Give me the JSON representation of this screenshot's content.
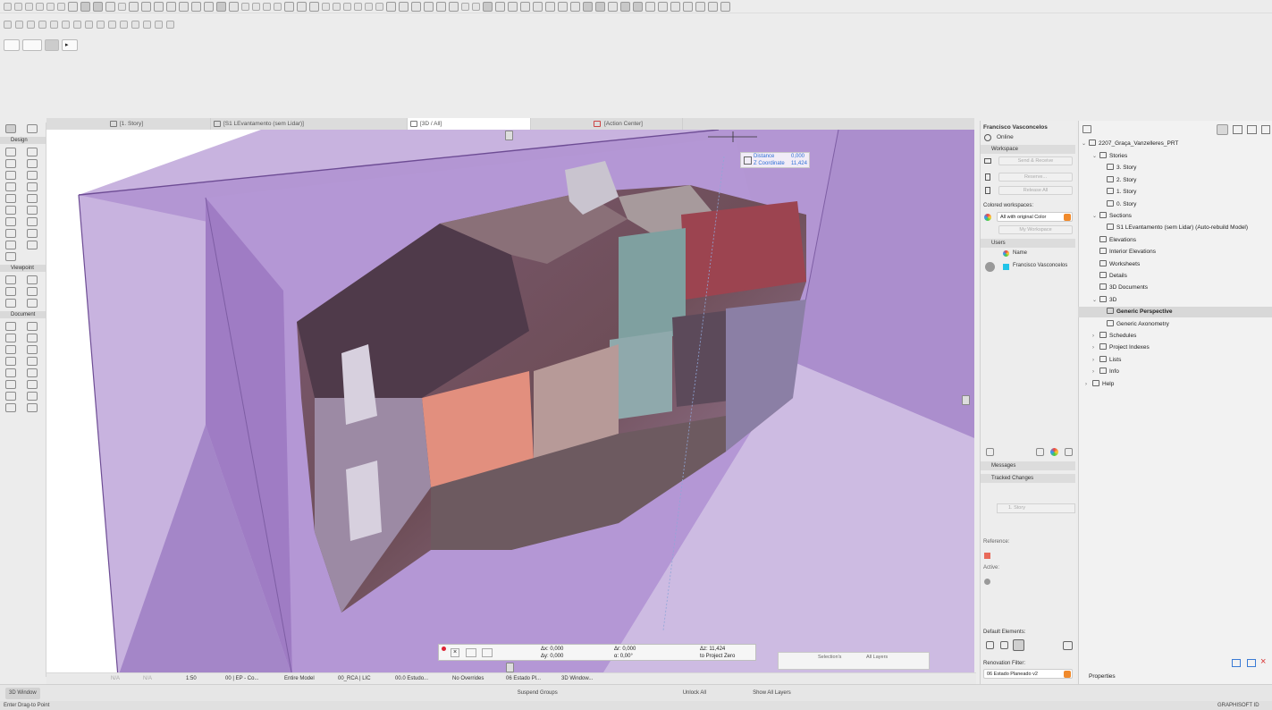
{
  "tabs": [
    "[1. Story]",
    "[S1 LEvantamento (sem Lidar)]",
    "[3D / All]",
    "[Action Center]"
  ],
  "infobox": {
    "marker": "▸"
  },
  "toolbox": {
    "design": "Design",
    "viewpoint": "Viewpoint",
    "document": "Document"
  },
  "tracker": {
    "distance_label": "Distance",
    "distance_value": "0,000",
    "z_label": "Z Coordinate",
    "z_value": "11,424"
  },
  "coord_bar": {
    "dx": "Δx: 0,000",
    "dy": "Δy: 0,000",
    "dr": "Δr: 0,000",
    "angle": "α: 0,00°",
    "dz": "Δz: 11,424",
    "project_zero": "to Project Zero"
  },
  "selection_box": {
    "selections": "Selection's",
    "all_layers": "All Layers"
  },
  "user_panel": {
    "user_name": "Francisco Vasconcelos",
    "status": "Online",
    "workspace_header": "Workspace",
    "send_receive": "Send & Receive",
    "reserve": "Reserve...",
    "release_all": "Release All",
    "colored_label": "Colored workspaces:",
    "colored_value": "All with original Color",
    "my_workspace": "My Workspace",
    "users_header": "Users",
    "users_col": "Name",
    "user_entry": "Francisco Vasconcelos",
    "messages": "Messages",
    "tracked_changes": "Tracked Changes",
    "story_field": "1. Story",
    "reference": "Reference:",
    "active": "Active:",
    "default_elements": "Default Elements:",
    "renovation_filter": "Renovation Filter:",
    "renovation_value": "06 Estado Planeado v2"
  },
  "navigator": {
    "project": "2207_Graça_Vanzelleres_PRT",
    "items": [
      {
        "label": "Stories",
        "indent": 1,
        "arrow": "⌄"
      },
      {
        "label": "3. Story",
        "indent": 2,
        "arrow": ""
      },
      {
        "label": "2. Story",
        "indent": 2,
        "arrow": ""
      },
      {
        "label": "1. Story",
        "indent": 2,
        "arrow": ""
      },
      {
        "label": "0. Story",
        "indent": 2,
        "arrow": ""
      },
      {
        "label": "Sections",
        "indent": 1,
        "arrow": "⌄"
      },
      {
        "label": "S1 LEvantamento (sem Lidar) (Auto-rebuild Model)",
        "indent": 2,
        "arrow": ""
      },
      {
        "label": "Elevations",
        "indent": 1,
        "arrow": ""
      },
      {
        "label": "Interior Elevations",
        "indent": 1,
        "arrow": ""
      },
      {
        "label": "Worksheets",
        "indent": 1,
        "arrow": ""
      },
      {
        "label": "Details",
        "indent": 1,
        "arrow": ""
      },
      {
        "label": "3D Documents",
        "indent": 1,
        "arrow": ""
      },
      {
        "label": "3D",
        "indent": 1,
        "arrow": "⌄"
      },
      {
        "label": "Generic Perspective",
        "indent": 2,
        "arrow": ""
      },
      {
        "label": "Generic Axonometry",
        "indent": 2,
        "arrow": ""
      },
      {
        "label": "Schedules",
        "indent": 1,
        "arrow": "›"
      },
      {
        "label": "Project Indexes",
        "indent": 1,
        "arrow": "›"
      },
      {
        "label": "Lists",
        "indent": 1,
        "arrow": "›"
      },
      {
        "label": "Info",
        "indent": 1,
        "arrow": "›"
      },
      {
        "label": "Help",
        "indent": 0,
        "arrow": "›"
      }
    ],
    "properties": "Properties"
  },
  "quick_options": {
    "na1": "N/A",
    "na2": "N/A",
    "scale": "1:50",
    "layer_combo": "00 | EP - Co...",
    "model": "Entire Model",
    "pen_set": "00_RCA | LIC",
    "mvo": "00.0 Estudo...",
    "overrides": "No Overrides",
    "renovation": "06 Estado Pl...",
    "view_type": "3D Window..."
  },
  "bottom": {
    "window": "3D Window",
    "suspend_groups": "Suspend Groups",
    "unlock_all": "Unlock All",
    "show_all_layers": "Show All Layers",
    "graphisoft_id": "GRAPHISOFT ID"
  },
  "status": "Enter Drag-to Point",
  "colors": {
    "purple_light": "#c9b4e0",
    "purple_mid": "#ae93cf",
    "purple_dark": "#8e6cb7",
    "accent": "#2f6fd6",
    "orange": "#f08a2c"
  }
}
